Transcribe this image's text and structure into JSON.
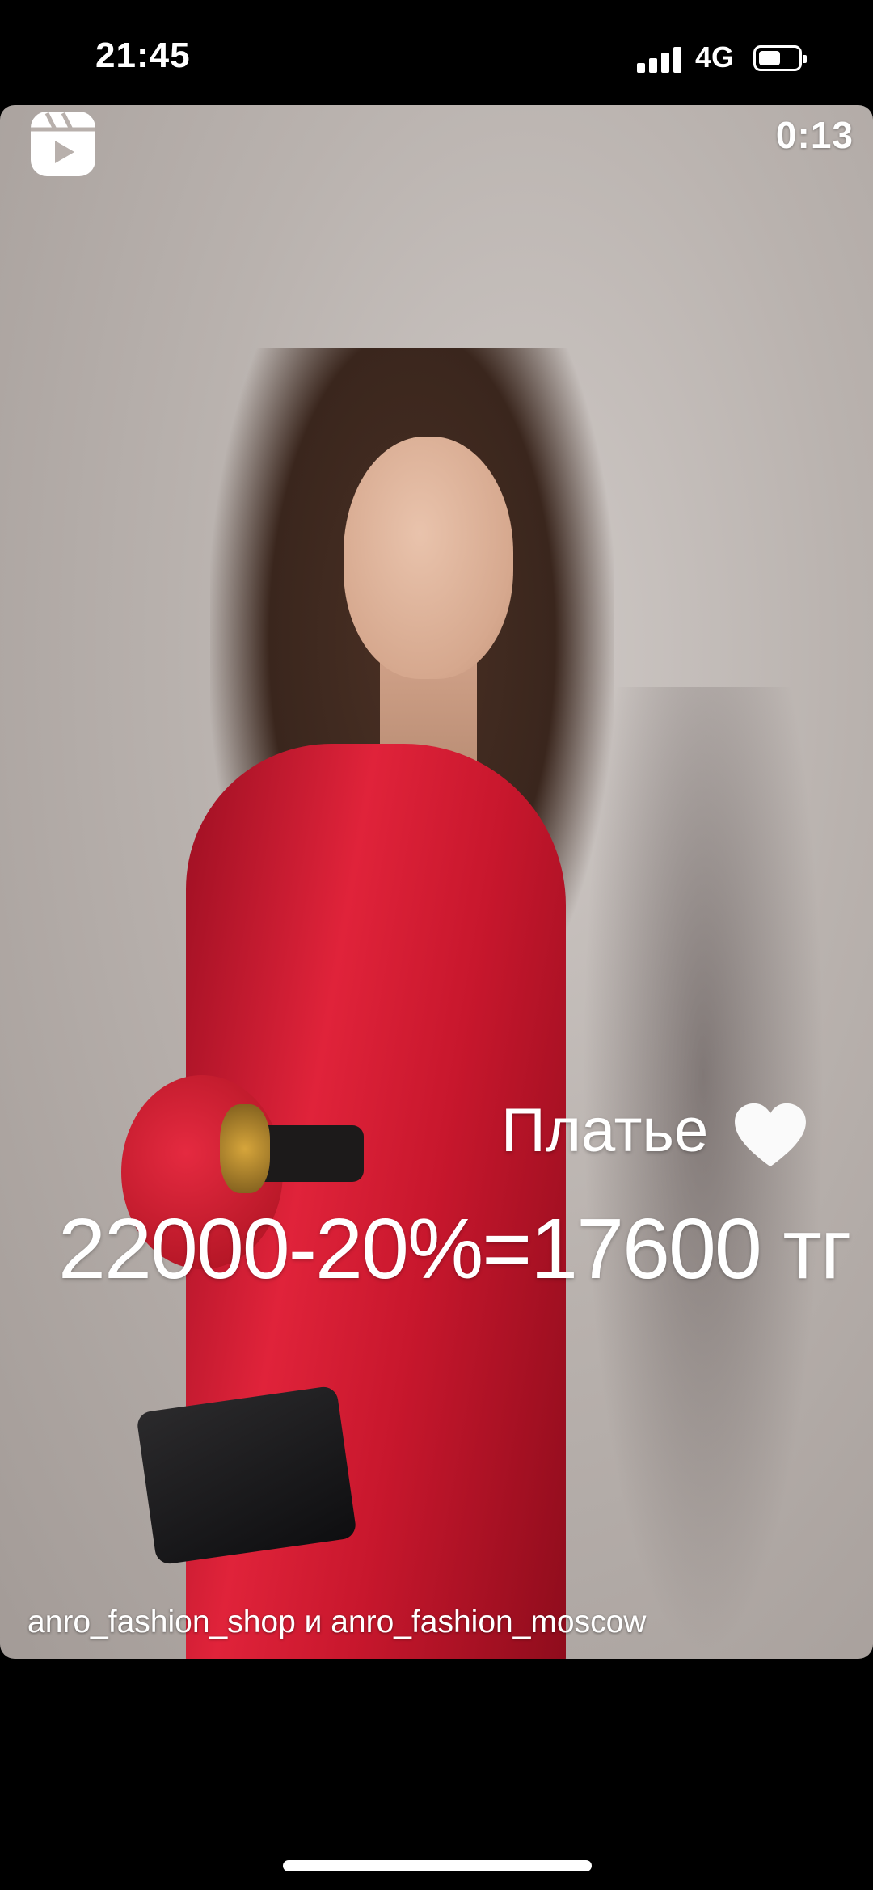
{
  "status_bar": {
    "time": "21:45",
    "network": "4G",
    "signal_icon": "cellular-signal-icon",
    "battery_icon": "battery-icon"
  },
  "video": {
    "reels_icon": "reels-icon",
    "timer": "0:13",
    "caption_product": "Платье",
    "caption_heart_icon": "white-heart-icon",
    "caption_price": "22000-20%=17600 тг",
    "credits": "anro_fashion_shop и anro_fashion_moscow"
  },
  "colors": {
    "background": "#000000",
    "text": "#ffffff",
    "dress": "#d61f35"
  }
}
